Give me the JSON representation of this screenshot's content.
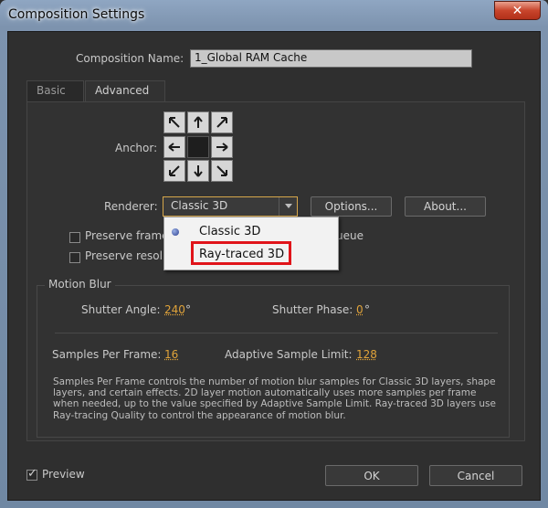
{
  "window": {
    "title": "Composition Settings",
    "close_label": "✕"
  },
  "composition_name": {
    "label": "Composition Name:",
    "value": "1_Global RAM Cache"
  },
  "tabs": [
    {
      "label": "Basic"
    },
    {
      "label": "Advanced"
    }
  ],
  "anchor": {
    "label": "Anchor:"
  },
  "renderer": {
    "label": "Renderer:",
    "selected": "Classic 3D",
    "options_button": "Options...",
    "about_button": "About...",
    "menu": [
      {
        "label": "Classic 3D",
        "selected": true
      },
      {
        "label": "Ray-traced 3D",
        "highlighted": true
      }
    ]
  },
  "checkboxes": [
    {
      "label": "Preserve frame",
      "suffix": "ueue"
    },
    {
      "label": "Preserve resol"
    }
  ],
  "motion_blur": {
    "title": "Motion Blur",
    "shutter_angle": {
      "label": "Shutter Angle:",
      "value": "240",
      "unit": "°"
    },
    "shutter_phase": {
      "label": "Shutter Phase:",
      "value": "0",
      "unit": "°"
    },
    "samples_per_frame": {
      "label": "Samples Per Frame:",
      "value": "16"
    },
    "adaptive_sample_limit": {
      "label": "Adaptive Sample Limit:",
      "value": "128"
    },
    "description": "Samples Per Frame controls the number of motion blur samples for Classic 3D layers, shape layers, and certain effects. 2D layer motion automatically uses more samples per frame when needed, up to the value specified by Adaptive Sample Limit. Ray-traced 3D layers use Ray-tracing Quality to control the appearance of motion blur."
  },
  "preview": {
    "label": "Preview",
    "checked": true
  },
  "buttons": {
    "ok": "OK",
    "cancel": "Cancel"
  },
  "colors": {
    "accent": "#e0a33a",
    "highlight": "#e0141a"
  }
}
